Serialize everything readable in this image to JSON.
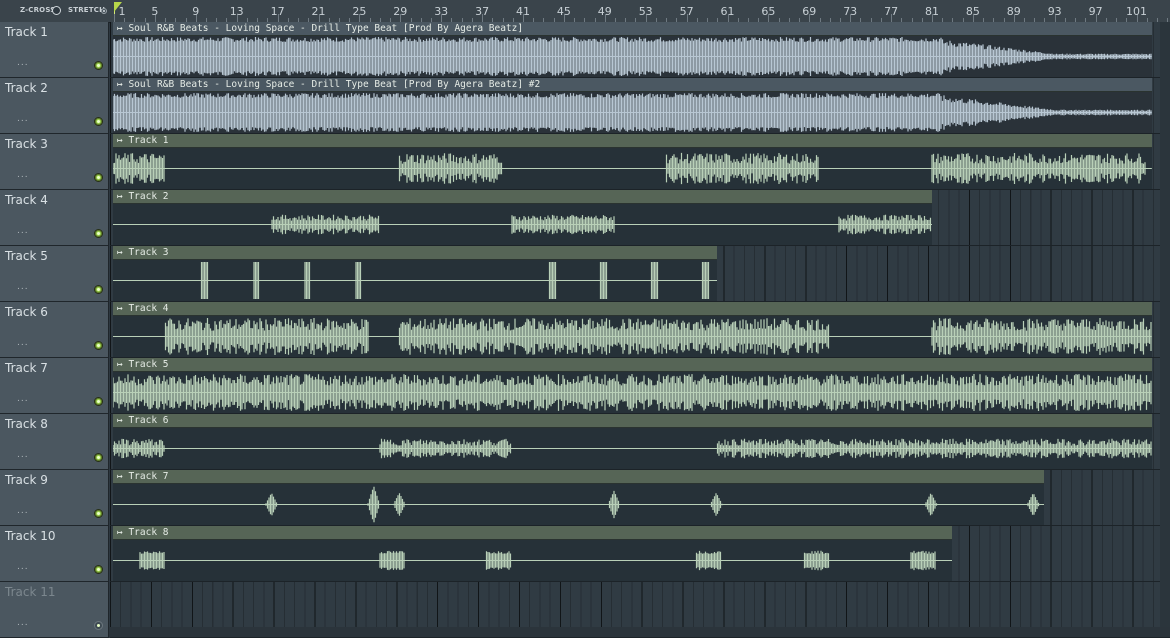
{
  "options": {
    "zcross": "Z-CROSS",
    "stretch": "STRETCH"
  },
  "ruler": [
    "1",
    "5",
    "9",
    "13",
    "17",
    "21",
    "25",
    "29",
    "33",
    "37",
    "41",
    "45",
    "49",
    "53",
    "57",
    "61",
    "65",
    "69",
    "73",
    "77",
    "81",
    "85",
    "89",
    "93",
    "97",
    "101"
  ],
  "tracks": [
    {
      "name": "Track 1"
    },
    {
      "name": "Track 2"
    },
    {
      "name": "Track 3"
    },
    {
      "name": "Track 4"
    },
    {
      "name": "Track 5"
    },
    {
      "name": "Track 6"
    },
    {
      "name": "Track 7"
    },
    {
      "name": "Track 8"
    },
    {
      "name": "Track 9"
    },
    {
      "name": "Track 10"
    },
    {
      "name": "Track 11"
    }
  ],
  "clips": [
    {
      "label": "Soul R&B Beats - Loving Space - Drill Type Beat [Prod By Agera Beatz]"
    },
    {
      "label": "Soul R&B Beats - Loving Space - Drill Type Beat [Prod By Agera Beatz] #2"
    },
    {
      "label": "Track 1"
    },
    {
      "label": "Track 2"
    },
    {
      "label": "Track 3"
    },
    {
      "label": "Track 4"
    },
    {
      "label": "Track 5"
    },
    {
      "label": "Track 6"
    },
    {
      "label": "Track 7"
    },
    {
      "label": "Track 8"
    }
  ],
  "colors": {
    "audio_wave": "#b8c7d3",
    "pattern_wave": "#b9d0b8",
    "led_on": "#9cd34a"
  }
}
